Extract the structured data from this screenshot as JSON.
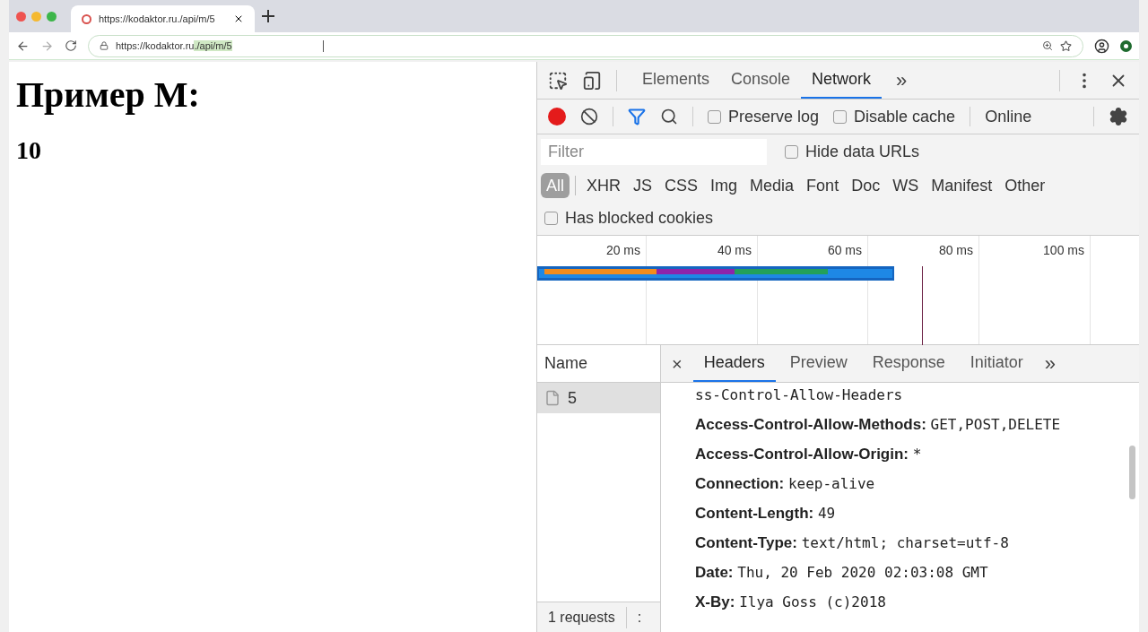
{
  "browser": {
    "tab_title": "https://kodaktor.ru./api/m/5",
    "url_host": "https://kodaktor.ru",
    "url_selected": "./api/m/5"
  },
  "page": {
    "heading": "Пример M:",
    "value": "10"
  },
  "devtools": {
    "tabs": [
      {
        "label": "Elements",
        "selected": false
      },
      {
        "label": "Console",
        "selected": false
      },
      {
        "label": "Network",
        "selected": true
      }
    ],
    "more_tabs": "»",
    "toolbar": {
      "recording": true,
      "filter_active": true,
      "preserve_log": {
        "label": "Preserve log",
        "checked": false
      },
      "disable_cache": {
        "label": "Disable cache",
        "checked": false
      },
      "throttling": "Online"
    },
    "filter": {
      "placeholder": "Filter",
      "hide_data_urls": {
        "label": "Hide data URLs",
        "checked": false
      }
    },
    "types": [
      {
        "label": "All",
        "selected": true
      },
      {
        "label": "XHR",
        "selected": false
      },
      {
        "label": "JS",
        "selected": false
      },
      {
        "label": "CSS",
        "selected": false
      },
      {
        "label": "Img",
        "selected": false
      },
      {
        "label": "Media",
        "selected": false
      },
      {
        "label": "Font",
        "selected": false
      },
      {
        "label": "Doc",
        "selected": false
      },
      {
        "label": "WS",
        "selected": false
      },
      {
        "label": "Manifest",
        "selected": false
      },
      {
        "label": "Other",
        "selected": false
      }
    ],
    "blocked_cookies": {
      "label": "Has blocked cookies",
      "checked": false
    },
    "timeline_ticks": [
      "20 ms",
      "40 ms",
      "60 ms",
      "80 ms",
      "100 ms"
    ],
    "name_column": "Name",
    "requests": [
      {
        "name": "5",
        "selected": true
      }
    ],
    "detail_close": "×",
    "detail_tabs": [
      {
        "label": "Headers",
        "selected": true
      },
      {
        "label": "Preview",
        "selected": false
      },
      {
        "label": "Response",
        "selected": false
      },
      {
        "label": "Initiator",
        "selected": false
      }
    ],
    "detail_more": "»",
    "header_cut": "ss-Control-Allow-Headers",
    "headers": [
      {
        "name": "Access-Control-Allow-Methods:",
        "value": "GET,POST,DELETE"
      },
      {
        "name": "Access-Control-Allow-Origin:",
        "value": "*"
      },
      {
        "name": "Connection:",
        "value": "keep-alive"
      },
      {
        "name": "Content-Length:",
        "value": "49"
      },
      {
        "name": "Content-Type:",
        "value": "text/html; charset=utf-8"
      },
      {
        "name": "Date:",
        "value": "Thu, 20 Feb 2020 02:03:08 GMT"
      },
      {
        "name": "X-By:",
        "value": "Ilya Goss (c)2018"
      }
    ],
    "status_bar": [
      "1 requests",
      ":"
    ]
  }
}
